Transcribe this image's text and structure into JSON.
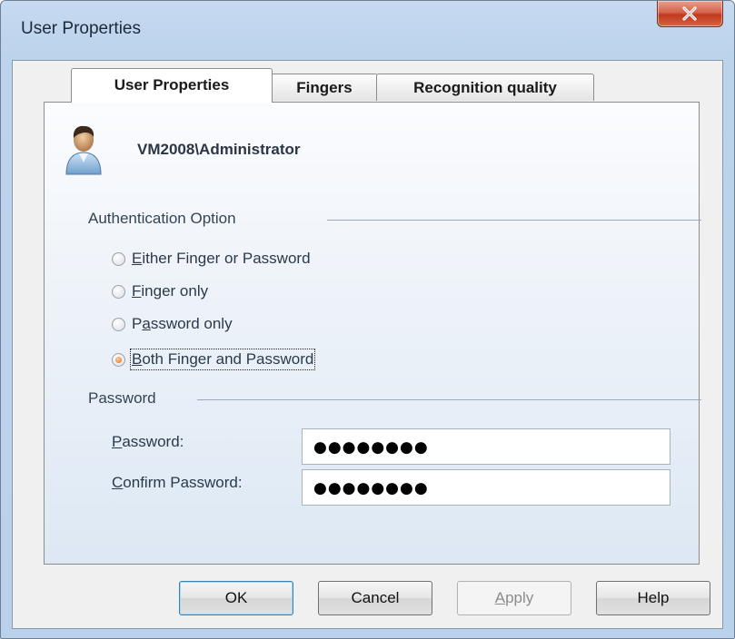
{
  "window": {
    "title": "User Properties",
    "close_icon": "close-x-icon"
  },
  "tabs": [
    {
      "label": "User Properties",
      "active": true
    },
    {
      "label": "Fingers",
      "active": false
    },
    {
      "label": "Recognition quality",
      "active": false
    }
  ],
  "user": {
    "icon": "user-avatar-icon",
    "name": "VM2008\\Administrator"
  },
  "auth": {
    "group_label": "Authentication Option",
    "options": [
      {
        "mnemonic": "E",
        "rest": "ither Finger or Password",
        "checked": false
      },
      {
        "mnemonic": "F",
        "rest": "inger only",
        "checked": false
      },
      {
        "pre": "P",
        "mnemonic": "a",
        "rest": "ssword only",
        "checked": false
      },
      {
        "mnemonic": "B",
        "rest": "oth Finger and Password",
        "checked": true
      }
    ]
  },
  "password": {
    "group_label": "Password",
    "password_label_mnemonic": "P",
    "password_label_rest": "assword:",
    "password_value": "●●●●●●●●",
    "confirm_label_mnemonic": "C",
    "confirm_label_rest": "onfirm Password:",
    "confirm_value": "●●●●●●●●"
  },
  "buttons": {
    "ok": "OK",
    "cancel": "Cancel",
    "apply_mnemonic": "A",
    "apply_rest": "pply",
    "help": "Help"
  },
  "colors": {
    "accent_radio": "#e06a10",
    "close_button": "#c0391f",
    "frame": "#bcd3ec"
  }
}
